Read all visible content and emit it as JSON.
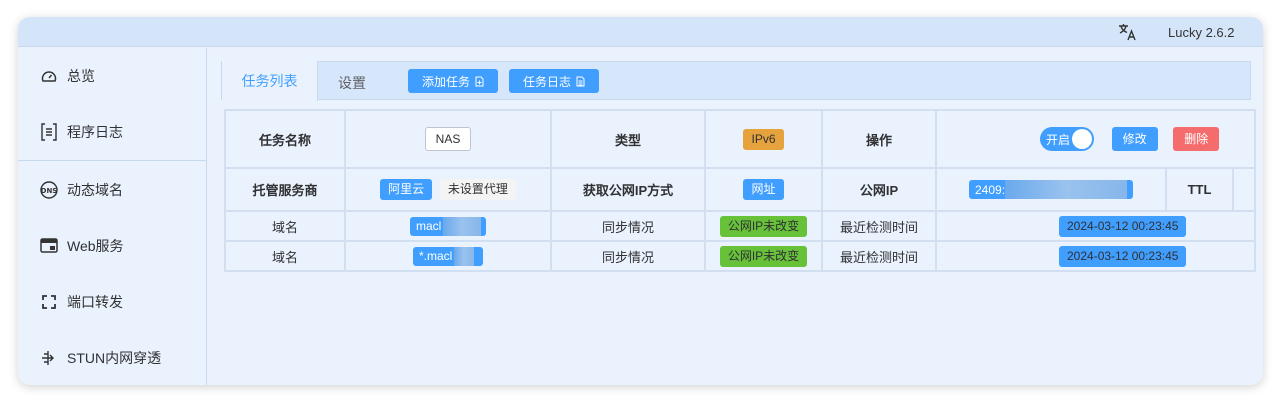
{
  "topbar": {
    "version": "Lucky 2.6.2",
    "lang_icon": "translate-icon"
  },
  "sidebar": {
    "items": [
      {
        "label": "总览",
        "icon": "dashboard-icon"
      },
      {
        "label": "程序日志",
        "icon": "log-icon"
      },
      {
        "label": "动态域名",
        "icon": "dns-icon"
      },
      {
        "label": "Web服务",
        "icon": "web-icon"
      },
      {
        "label": "端口转发",
        "icon": "port-forward-icon"
      },
      {
        "label": "STUN内网穿透",
        "icon": "stun-icon"
      }
    ]
  },
  "tabs": {
    "task_list": "任务列表",
    "settings": "设置",
    "add_task": "添加任务",
    "task_log": "任务日志"
  },
  "task": {
    "name_label": "任务名称",
    "name_value": "NAS",
    "type_label": "类型",
    "type_value": "IPv6",
    "op_label": "操作",
    "switch_label": "开启",
    "edit_label": "修改",
    "delete_label": "删除",
    "provider_label": "托管服务商",
    "provider_value": "阿里云",
    "proxy_value": "未设置代理",
    "ip_method_label": "获取公网IP方式",
    "ip_method_value": "网址",
    "public_ip_label": "公网IP",
    "public_ip_value": "2409:",
    "ttl_label": "TTL",
    "domains": [
      {
        "label": "域名",
        "value": "macl",
        "sync_label": "同步情况",
        "sync_value": "公网IP未改变",
        "check_label": "最近检测时间",
        "check_time": "2024-03-12 00:23:45"
      },
      {
        "label": "域名",
        "value": "*.macl",
        "sync_label": "同步情况",
        "sync_value": "公网IP未改变",
        "check_label": "最近检测时间",
        "check_time": "2024-03-12 00:23:45"
      }
    ]
  },
  "colors": {
    "accent": "#409eff",
    "danger": "#f56c6c",
    "warning": "#e6a23c",
    "success": "#67c23a"
  }
}
